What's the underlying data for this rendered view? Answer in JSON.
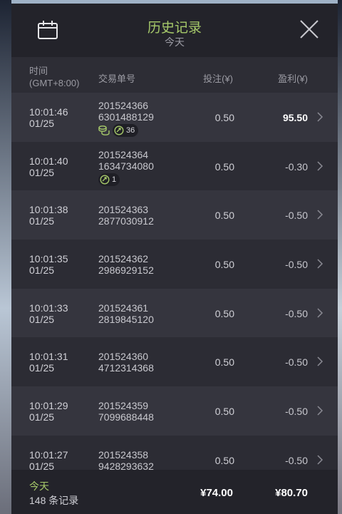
{
  "header": {
    "title": "历史记录",
    "subtitle": "今天"
  },
  "columns": {
    "time_line1": "时间",
    "time_line2": "(GMT+8:00)",
    "order": "交易单号",
    "bet": "投注(¥)",
    "profit": "盈利(¥)"
  },
  "rows": [
    {
      "time": "10:01:46",
      "date": "01/25",
      "order1": "201524366",
      "order2": "6301488129",
      "bet": "0.50",
      "profit": "95.50",
      "positive": true,
      "coins": true,
      "free_spins": "36"
    },
    {
      "time": "10:01:40",
      "date": "01/25",
      "order1": "201524364",
      "order2": "1634734080",
      "bet": "0.50",
      "profit": "-0.30",
      "positive": false,
      "coins": false,
      "free_spins": "1"
    },
    {
      "time": "10:01:38",
      "date": "01/25",
      "order1": "201524363",
      "order2": "2877030912",
      "bet": "0.50",
      "profit": "-0.50",
      "positive": false
    },
    {
      "time": "10:01:35",
      "date": "01/25",
      "order1": "201524362",
      "order2": "2986929152",
      "bet": "0.50",
      "profit": "-0.50",
      "positive": false
    },
    {
      "time": "10:01:33",
      "date": "01/25",
      "order1": "201524361",
      "order2": "2819845120",
      "bet": "0.50",
      "profit": "-0.50",
      "positive": false
    },
    {
      "time": "10:01:31",
      "date": "01/25",
      "order1": "201524360",
      "order2": "4712314368",
      "bet": "0.50",
      "profit": "-0.50",
      "positive": false
    },
    {
      "time": "10:01:29",
      "date": "01/25",
      "order1": "201524359",
      "order2": "7099688448",
      "bet": "0.50",
      "profit": "-0.50",
      "positive": false
    },
    {
      "time": "10:01:27",
      "date": "01/25",
      "order1": "201524358",
      "order2": "9428293632",
      "bet": "0.50",
      "profit": "-0.50",
      "positive": false
    }
  ],
  "footer": {
    "today": "今天",
    "count": "148 条记录",
    "total_bet": "¥74.00",
    "total_profit": "¥80.70"
  },
  "colors": {
    "accent": "#a6c96a",
    "panel": "#2a2a32",
    "row": "#35353e",
    "row_alt": "#2c2c34"
  },
  "icons": {
    "calendar": "calendar-icon",
    "close": "close-icon",
    "chevron": "chevron-right-icon",
    "coins": "coins-icon",
    "free_spin": "free-spin-icon"
  }
}
